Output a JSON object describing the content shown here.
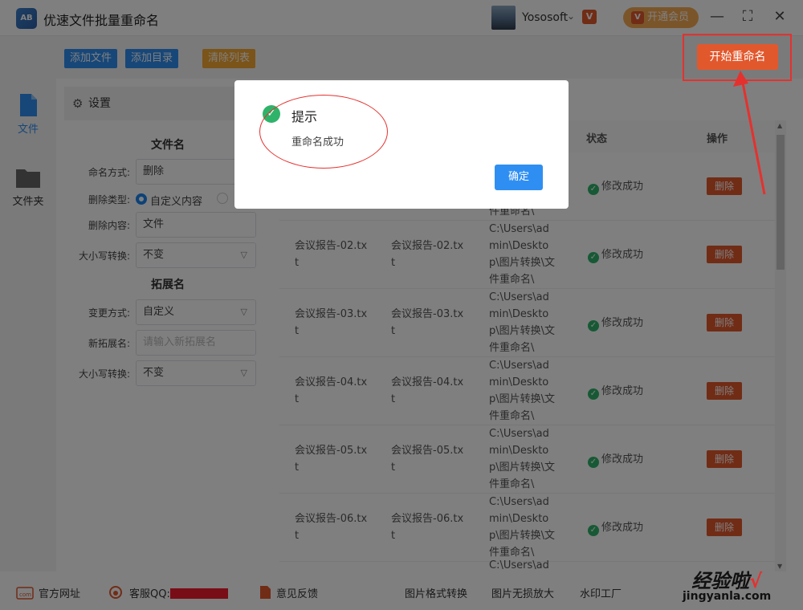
{
  "app": {
    "logo": "AB",
    "title": "优速文件批量重命名"
  },
  "user": {
    "name": "Yososoft",
    "vip_label": "开通会员",
    "vip_icon": "V"
  },
  "window_controls": {
    "minimize": "—",
    "maximize": "⛶",
    "close": "✕"
  },
  "toolbar": {
    "add_file": "添加文件",
    "add_dir": "添加目录",
    "clear_list": "清除列表",
    "start_rename": "开始重命名",
    "colors": {
      "add_file": "#2f8ef2",
      "add_dir": "#2f8ef2",
      "clear_list": "#f7a932",
      "start": "#e2582d"
    }
  },
  "sidebar": {
    "items": [
      {
        "label": "文件"
      },
      {
        "label": "文件夹"
      }
    ]
  },
  "settings": {
    "header": "设置",
    "filename_title": "文件名",
    "naming_mode_label": "命名方式:",
    "naming_mode_value": "删除",
    "delete_type_label": "删除类型:",
    "delete_type_value": "自定义内容",
    "delete_content_label": "删除内容:",
    "delete_content_value": "文件",
    "case_label": "大小写转换:",
    "case_value": "不变",
    "ext_title": "拓展名",
    "change_mode_label": "变更方式:",
    "change_mode_value": "自定义",
    "new_ext_label": "新拓展名:",
    "new_ext_placeholder": "请输入新拓展名",
    "ext_case_label": "大小写转换:",
    "ext_case_value": "不变"
  },
  "table": {
    "headers": {
      "status": "状态",
      "action": "操作"
    },
    "delete_label": "删除",
    "first_row_path_tail": "件重命名\\",
    "rows": [
      {
        "original": "",
        "new": "",
        "path": "",
        "status": "修改成功"
      },
      {
        "original": "会议报告-02.txt",
        "new": "会议报告-02.txt",
        "path": "C:\\Users\\admin\\Desktop\\图片转换\\文件重命名\\",
        "status": "修改成功"
      },
      {
        "original": "会议报告-03.txt",
        "new": "会议报告-03.txt",
        "path": "C:\\Users\\admin\\Desktop\\图片转换\\文件重命名\\",
        "status": "修改成功"
      },
      {
        "original": "会议报告-04.txt",
        "new": "会议报告-04.txt",
        "path": "C:\\Users\\admin\\Desktop\\图片转换\\文件重命名\\",
        "status": "修改成功"
      },
      {
        "original": "会议报告-05.txt",
        "new": "会议报告-05.txt",
        "path": "C:\\Users\\admin\\Desktop\\图片转换\\文件重命名\\",
        "status": "修改成功"
      },
      {
        "original": "会议报告-06.txt",
        "new": "会议报告-06.txt",
        "path": "C:\\Users\\admin\\Desktop\\图片转换\\文件重命名\\",
        "status": "修改成功"
      },
      {
        "original": "",
        "new": "",
        "path": "C:\\Users\\ad",
        "status": ""
      }
    ]
  },
  "footer": {
    "website": "官方网址",
    "support_prefix": "客服QQ:",
    "feedback": "意见反馈",
    "img_convert": "图片格式转换",
    "img_enlarge": "图片无损放大",
    "watermark": "水印工厂"
  },
  "dialog": {
    "title": "提示",
    "message": "重命名成功",
    "ok": "确定"
  },
  "watermark_brand": {
    "main": "经验啦",
    "check": "√",
    "sub": "jingyanla.com"
  }
}
